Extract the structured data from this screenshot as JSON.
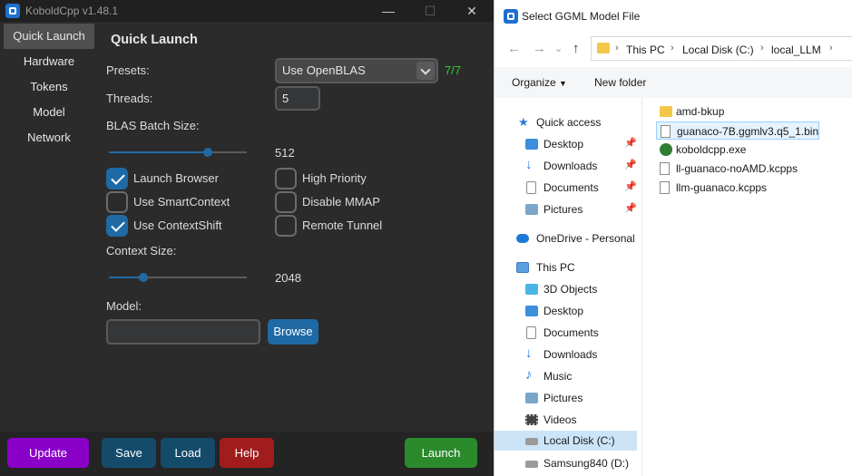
{
  "kobold": {
    "title": "KoboldCpp v1.48.1",
    "window_controls": {
      "minimize": "—",
      "maximize": "☐",
      "close": "✕"
    },
    "sidebar": [
      {
        "label": "Quick Launch",
        "active": true
      },
      {
        "label": "Hardware",
        "active": false
      },
      {
        "label": "Tokens",
        "active": false
      },
      {
        "label": "Model",
        "active": false
      },
      {
        "label": "Network",
        "active": false
      }
    ],
    "main": {
      "heading": "Quick Launch",
      "presets_label": "Presets:",
      "presets_value": "Use OpenBLAS",
      "gpu_count": "7/7",
      "threads_label": "Threads:",
      "threads_value": "5",
      "blas_label": "BLAS Batch Size:",
      "blas_value": "512",
      "blas_slider_fraction": 0.72,
      "checkboxes": [
        {
          "label": "Launch Browser",
          "checked": true
        },
        {
          "label": "High Priority",
          "checked": false
        },
        {
          "label": "Use SmartContext",
          "checked": false
        },
        {
          "label": "Disable MMAP",
          "checked": false
        },
        {
          "label": "Use ContextShift",
          "checked": true
        },
        {
          "label": "Remote Tunnel",
          "checked": false
        }
      ],
      "context_label": "Context Size:",
      "context_value": "2048",
      "context_slider_fraction": 0.25,
      "model_label": "Model:",
      "model_value": "",
      "browse_label": "Browse"
    },
    "bottom": {
      "update_label": "Update",
      "save_label": "Save",
      "load_label": "Load",
      "help_label": "Help",
      "launch_label": "Launch"
    },
    "colors": {
      "update": "#8b00c9",
      "save": "#144b6b",
      "help": "#a11d1d",
      "launch": "#2b8a2b",
      "accent": "#1f6aa5",
      "gpu_count": "#33cc33"
    }
  },
  "dialog": {
    "title": "Select GGML Model File",
    "breadcrumbs": [
      "This PC",
      "Local Disk (C:)",
      "local_LLM"
    ],
    "toolbar": {
      "organize": "Organize",
      "new_folder": "New folder"
    },
    "nav": [
      {
        "label": "Quick access",
        "icon": "star-icon",
        "indent": 0,
        "pinned": false
      },
      {
        "label": "Desktop",
        "icon": "desktop-icon",
        "indent": 1,
        "pinned": true
      },
      {
        "label": "Downloads",
        "icon": "downloads-icon",
        "indent": 1,
        "pinned": true
      },
      {
        "label": "Documents",
        "icon": "documents-icon",
        "indent": 1,
        "pinned": true
      },
      {
        "label": "Pictures",
        "icon": "pictures-icon",
        "indent": 1,
        "pinned": true
      },
      {
        "label": "OneDrive - Personal",
        "icon": "cloud-icon",
        "indent": 0,
        "pinned": false
      },
      {
        "label": "This PC",
        "icon": "pc-icon",
        "indent": 0,
        "pinned": false
      },
      {
        "label": "3D Objects",
        "icon": "cube-icon",
        "indent": 1,
        "pinned": false
      },
      {
        "label": "Desktop",
        "icon": "desktop-icon",
        "indent": 1,
        "pinned": false
      },
      {
        "label": "Documents",
        "icon": "documents-icon",
        "indent": 1,
        "pinned": false
      },
      {
        "label": "Downloads",
        "icon": "downloads-icon",
        "indent": 1,
        "pinned": false
      },
      {
        "label": "Music",
        "icon": "music-icon",
        "indent": 1,
        "pinned": false
      },
      {
        "label": "Pictures",
        "icon": "pictures-icon",
        "indent": 1,
        "pinned": false
      },
      {
        "label": "Videos",
        "icon": "videos-icon",
        "indent": 1,
        "pinned": false
      },
      {
        "label": "Local Disk (C:)",
        "icon": "drive-icon",
        "indent": 1,
        "pinned": false,
        "selected": true
      },
      {
        "label": "Samsung840 (D:)",
        "icon": "drive-icon",
        "indent": 1,
        "pinned": false
      }
    ],
    "files": [
      {
        "name": "amd-bkup",
        "type": "folder"
      },
      {
        "name": "guanaco-7B.ggmlv3.q5_1.bin",
        "type": "file",
        "selected": true
      },
      {
        "name": "koboldcpp.exe",
        "type": "exe"
      },
      {
        "name": "ll-guanaco-noAMD.kcpps",
        "type": "file"
      },
      {
        "name": "llm-guanaco.kcpps",
        "type": "file"
      }
    ]
  }
}
